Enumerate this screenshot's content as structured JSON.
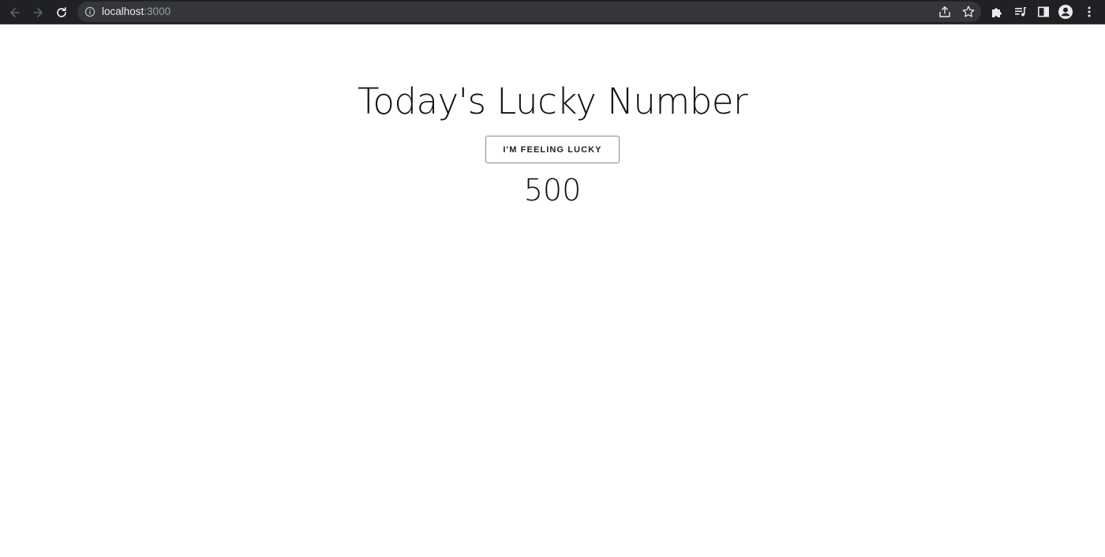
{
  "browser": {
    "url_host": "localhost",
    "url_port": ":3000",
    "icons": {
      "back": "arrow-left-icon",
      "forward": "arrow-right-icon",
      "reload": "reload-icon",
      "site_info": "info-icon",
      "share": "share-icon",
      "bookmark": "star-icon",
      "extensions": "puzzle-icon",
      "media": "media-queue-icon",
      "side_panel": "side-panel-icon",
      "profile": "profile-icon",
      "menu": "kebab-menu-icon"
    },
    "colors": {
      "toolbar_bg": "#202124",
      "omnibox_bg": "#35363a",
      "host_text": "#e8eaed",
      "port_text": "#9aa0a6"
    }
  },
  "page": {
    "title": "Today's Lucky Number",
    "button_label": "I'M FEELING LUCKY",
    "lucky_number": "500",
    "colors": {
      "background": "#ffffff",
      "text": "#111111",
      "button_border": "#888888"
    }
  }
}
